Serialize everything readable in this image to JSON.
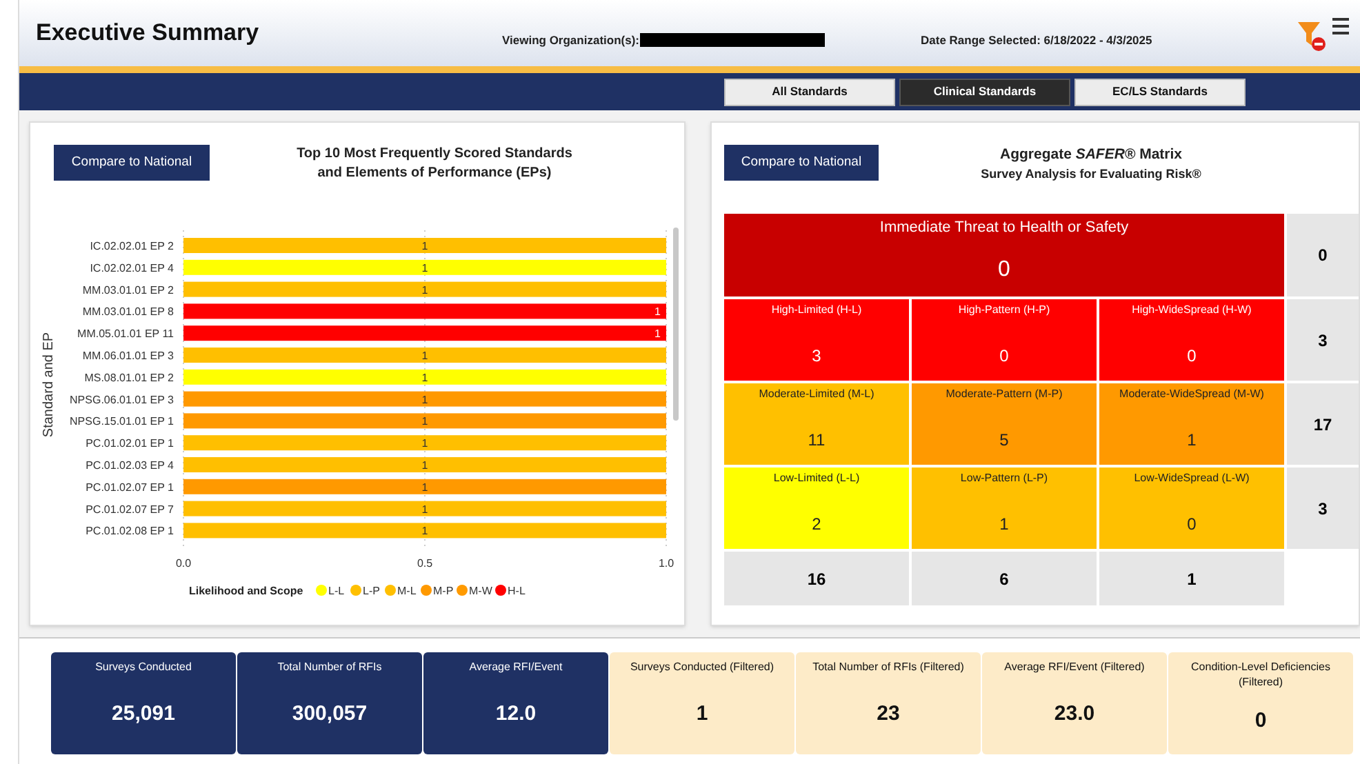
{
  "header": {
    "title": "Executive Summary",
    "organization_label": "Viewing Organization(s):",
    "date_range": "Date Range Selected: 6/18/2022 - 4/3/2025"
  },
  "tabs": [
    {
      "label": "All Standards",
      "selected": false
    },
    {
      "label": "Clinical Standards",
      "selected": true
    },
    {
      "label": "EC/LS Standards",
      "selected": false
    }
  ],
  "left_panel": {
    "button": "Compare to National",
    "title": "Top 10 Most Frequently Scored Standards",
    "subtitle": "and Elements of Performance (EPs)",
    "chart_data": {
      "type": "bar",
      "orientation": "horizontal",
      "stacked": true,
      "ylabel": "Standard and EP",
      "legend": {
        "title": "Likelihood and Scope"
      },
      "data_labels": true,
      "xlim": [
        0,
        1
      ],
      "xticks": [
        {
          "value": 0,
          "label": "0.0"
        },
        {
          "value": 0.5,
          "label": "0.5"
        },
        {
          "value": 1,
          "label": "1.0"
        }
      ],
      "categories": [
        "IC.02.02.01 EP 2",
        "IC.02.02.01 EP 4",
        "MM.03.01.01 EP 2",
        "MM.03.01.01 EP 8",
        "MM.05.01.01 EP 11",
        "MM.06.01.01 EP 3",
        "MS.08.01.01 EP 2",
        "NPSG.06.01.01 EP 3",
        "NPSG.15.01.01 EP 1",
        "PC.01.02.01 EP 1",
        "PC.01.02.03 EP 4",
        "PC.01.02.07 EP 1",
        "PC.01.02.07 EP 7",
        "PC.01.02.08 EP 1"
      ],
      "series": [
        {
          "name": "L-L",
          "color": "#ffff00",
          "values": [
            null,
            1,
            null,
            null,
            null,
            null,
            1,
            null,
            null,
            null,
            null,
            null,
            null,
            null
          ]
        },
        {
          "name": "L-P",
          "color": "#ffc000",
          "values": [
            null,
            null,
            null,
            null,
            null,
            null,
            null,
            null,
            null,
            null,
            null,
            null,
            null,
            null
          ]
        },
        {
          "name": "M-L",
          "color": "#ffbf00",
          "values": [
            1,
            null,
            1,
            null,
            null,
            1,
            null,
            null,
            null,
            1,
            1,
            null,
            1,
            1
          ]
        },
        {
          "name": "M-P",
          "color": "#ff9900",
          "values": [
            null,
            null,
            null,
            null,
            null,
            null,
            null,
            1,
            1,
            null,
            null,
            1,
            null,
            null
          ]
        },
        {
          "name": "M-W",
          "color": "#ff9a00",
          "values": [
            null,
            null,
            null,
            null,
            null,
            null,
            null,
            null,
            null,
            null,
            null,
            null,
            null,
            null
          ]
        },
        {
          "name": "H-L",
          "color": "#ff0000",
          "values": [
            null,
            null,
            null,
            1,
            1,
            null,
            null,
            null,
            null,
            null,
            null,
            null,
            null,
            null
          ]
        }
      ]
    }
  },
  "right_panel": {
    "button": "Compare to National",
    "title_parts": [
      "Aggregate",
      "SAFER®",
      "Matrix"
    ],
    "subtitle": "Survey Analysis for Evaluating Risk®",
    "matrix": {
      "immediate_threat": {
        "label": "Immediate Threat to Health or Safety",
        "value": "0",
        "total": "0"
      },
      "rows": [
        {
          "total": "3",
          "cells": [
            {
              "label": "High-Limited (H-L)",
              "value": "3",
              "color": "#ff0000"
            },
            {
              "label": "High-Pattern (H-P)",
              "value": "0",
              "color": "#ff0000"
            },
            {
              "label": "High-WideSpread (H-W)",
              "value": "0",
              "color": "#ff0000"
            }
          ]
        },
        {
          "total": "17",
          "cells": [
            {
              "label": "Moderate-Limited (M-L)",
              "value": "11",
              "color": "#ffc000"
            },
            {
              "label": "Moderate-Pattern (M-P)",
              "value": "5",
              "color": "#ff9900"
            },
            {
              "label": "Moderate-WideSpread (M-W)",
              "value": "1",
              "color": "#ff9900"
            }
          ]
        },
        {
          "total": "3",
          "cells": [
            {
              "label": "Low-Limited (L-L)",
              "value": "2",
              "color": "#ffff00"
            },
            {
              "label": "Low-Pattern (L-P)",
              "value": "1",
              "color": "#ffc000"
            },
            {
              "label": "Low-WideSpread (L-W)",
              "value": "0",
              "color": "#ffc000"
            }
          ]
        }
      ],
      "column_totals": [
        "16",
        "6",
        "1"
      ]
    }
  },
  "cards": [
    {
      "label": "Surveys Conducted",
      "value": "25,091",
      "kind": "overall"
    },
    {
      "label": "Total Number of RFIs",
      "value": "300,057",
      "kind": "overall"
    },
    {
      "label": "Average RFI/Event",
      "value": "12.0",
      "kind": "overall"
    },
    {
      "label": "Surveys Conducted (Filtered)",
      "value": "1",
      "kind": "filtered"
    },
    {
      "label": "Total Number of RFIs (Filtered)",
      "value": "23",
      "kind": "filtered"
    },
    {
      "label": "Average RFI/Event (Filtered)",
      "value": "23.0",
      "kind": "filtered"
    },
    {
      "label": "Condition-Level Deficiencies (Filtered)",
      "value": "0",
      "kind": "filtered"
    }
  ]
}
